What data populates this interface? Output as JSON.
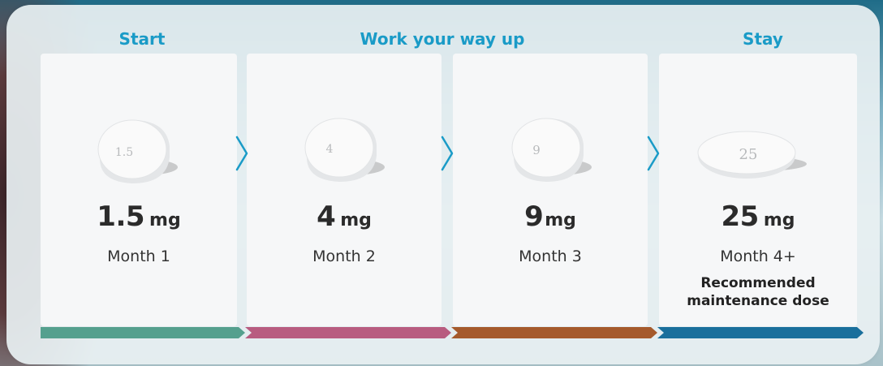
{
  "headings": {
    "start": "Start",
    "work": "Work your way up",
    "stay": "Stay"
  },
  "steps": [
    {
      "pill_text": "1.5",
      "dose_value": "1.5",
      "dose_unit": "mg",
      "month": "Month 1",
      "bar_color": "#55a08e"
    },
    {
      "pill_text": "4",
      "dose_value": "4",
      "dose_unit": "mg",
      "month": "Month 2",
      "bar_color": "#b85c80"
    },
    {
      "pill_text": "9",
      "dose_value": "9",
      "dose_unit": "mg",
      "month": "Month 3",
      "bar_color": "#a55a2c"
    },
    {
      "pill_text": "25",
      "dose_value": "25",
      "dose_unit": "mg",
      "month": "Month 4+",
      "bar_color": "#1a6f9c"
    }
  ],
  "maintenance_note": "Recommended maintenance dose",
  "colors": {
    "heading": "#1a9bc7",
    "chevron": "#1a9bc7",
    "card_bg": "#e8f0f2"
  },
  "icons": {
    "chevron": "chevron-right-icon",
    "pill": "pill-tablet-icon"
  }
}
